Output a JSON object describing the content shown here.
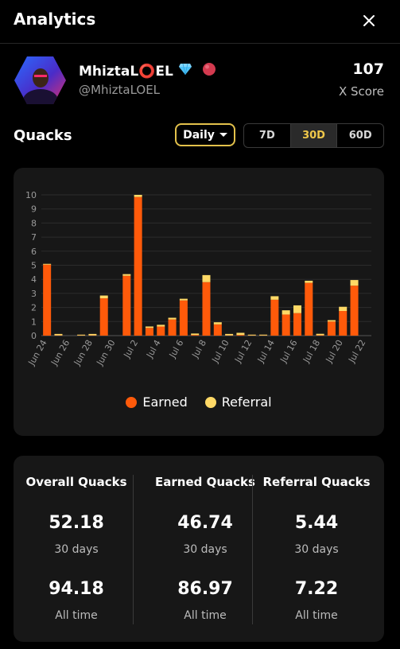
{
  "header": {
    "title": "Analytics"
  },
  "profile": {
    "name": "MhiztaL⭕EL",
    "handle": "@MhiztaLOEL",
    "score": "107",
    "score_label": "X Score",
    "badges": [
      "diamond-icon",
      "red-orb-icon"
    ]
  },
  "quacks": {
    "title": "Quacks",
    "period_dropdown": "Daily",
    "ranges": [
      "7D",
      "30D",
      "60D"
    ],
    "active_range": "30D"
  },
  "chart_data": {
    "type": "bar",
    "stacked": true,
    "categories": [
      "Jun 24",
      "Jun 25",
      "Jun 26",
      "Jun 27",
      "Jun 28",
      "Jun 29",
      "Jun 30",
      "Jul 1",
      "Jul 2",
      "Jul 3",
      "Jul 4",
      "Jul 5",
      "Jul 6",
      "Jul 7",
      "Jul 8",
      "Jul 9",
      "Jul 10",
      "Jul 11",
      "Jul 12",
      "Jul 13",
      "Jul 14",
      "Jul 15",
      "Jul 16",
      "Jul 17",
      "Jul 18",
      "Jul 19",
      "Jul 20",
      "Jul 21",
      "Jul 22"
    ],
    "tick_labels": [
      "Jun 24",
      "Jun 26",
      "Jun 28",
      "Jun 30",
      "Jul 2",
      "Jul 4",
      "Jul 6",
      "Jul 8",
      "Jul 10",
      "Jul 12",
      "Jul 14",
      "Jul 16",
      "Jul 18",
      "Jul 20",
      "Jul 22"
    ],
    "series": [
      {
        "name": "Earned",
        "color": "#ff5a0a",
        "values": [
          5.05,
          0.02,
          0,
          0.02,
          0.02,
          2.65,
          0,
          4.25,
          9.85,
          0.55,
          0.65,
          1.15,
          2.5,
          0.05,
          3.8,
          0.8,
          0.02,
          0.05,
          0.02,
          0.02,
          2.55,
          1.5,
          1.6,
          3.75,
          0.03,
          1.0,
          1.75,
          3.55,
          0
        ]
      },
      {
        "name": "Referral",
        "color": "#ffd966",
        "values": [
          0.05,
          0.1,
          0,
          0.05,
          0.1,
          0.2,
          0,
          0.12,
          0.15,
          0.1,
          0.12,
          0.12,
          0.12,
          0.1,
          0.5,
          0.15,
          0.1,
          0.15,
          0.05,
          0.05,
          0.25,
          0.3,
          0.55,
          0.15,
          0.1,
          0.1,
          0.3,
          0.4,
          0
        ]
      }
    ],
    "ylim": [
      0,
      10
    ],
    "yticks": [
      0,
      1,
      2,
      3,
      4,
      5,
      6,
      7,
      8,
      9,
      10
    ],
    "grid": true,
    "legend": "bottom-center"
  },
  "legend": {
    "earned": "Earned",
    "referral": "Referral"
  },
  "stats": [
    {
      "title": "Overall Quacks",
      "period_value": "52.18",
      "period_label": "30 days",
      "alltime_value": "94.18",
      "alltime_label": "All time"
    },
    {
      "title": "Earned Quacks",
      "period_value": "46.74",
      "period_label": "30 days",
      "alltime_value": "86.97",
      "alltime_label": "All time"
    },
    {
      "title": "Referral Quacks",
      "period_value": "5.44",
      "period_label": "30 days",
      "alltime_value": "7.22",
      "alltime_label": "All time"
    }
  ]
}
